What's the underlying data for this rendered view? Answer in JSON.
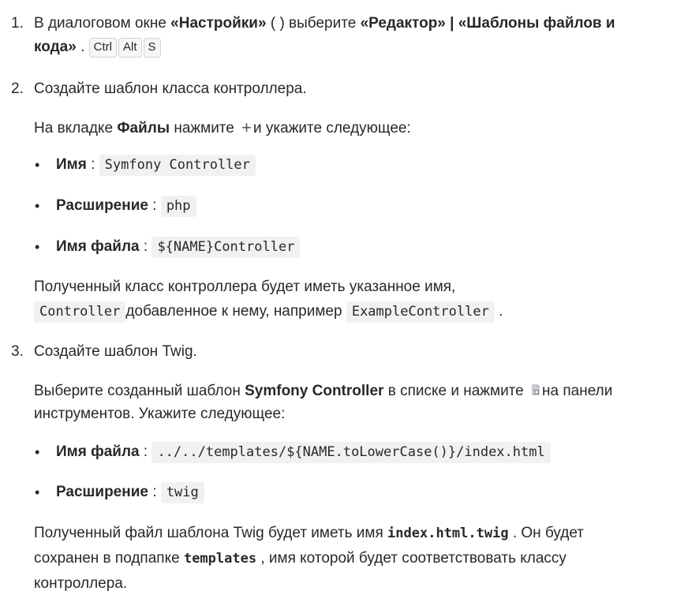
{
  "step1": {
    "number": "1.",
    "t1": "В диалоговом окне ",
    "settings": "«Настройки»",
    "t2": " ( ) выберите ",
    "editor": "«Редактор» | «Шаблоны файлов и",
    "code_kw": "кода»",
    "t3": " .",
    "keys": [
      "Ctrl",
      "Alt",
      "S"
    ]
  },
  "step2": {
    "number": "2.",
    "title": "Создайте шаблон класса контроллера.",
    "tab_pre": "На вкладке ",
    "tab_name": "Файлы",
    "tab_mid": " нажмите ",
    "plus_glyph": "+",
    "tab_post": "и укажите следующее:",
    "fields": [
      {
        "label": "Имя",
        "sep": " : ",
        "value": "Symfony Controller"
      },
      {
        "label": "Расширение",
        "sep": " : ",
        "value": "php"
      },
      {
        "label": "Имя файла",
        "sep": " : ",
        "value": "${NAME}Controller"
      }
    ],
    "result_line1": "Полученный класс контроллера будет иметь указанное имя,",
    "result_code1": "Controller",
    "result_mid": "добавленное к нему, например ",
    "result_code2": "ExampleController",
    "result_end": " ."
  },
  "step3": {
    "number": "3.",
    "title": "Создайте шаблон Twig.",
    "sel_pre": "Выберите созданный шаблон ",
    "sel_name": "Symfony Controller",
    "sel_mid": " в списке и нажмите ",
    "sel_post": "на панели",
    "sel_line2": "инструментов. Укажите следующее:",
    "fields": [
      {
        "label": "Имя файла",
        "sep": " : ",
        "value": "../../templates/${NAME.toLowerCase()}/index.html"
      },
      {
        "label": "Расширение",
        "sep": " : ",
        "value": "twig"
      }
    ],
    "res_pre": "Полученный файл шаблона Twig будет иметь имя ",
    "res_file": "index.html.twig",
    "res_mid": " . Он будет",
    "res_line2_pre": "сохранен в подпапке ",
    "res_folder": "templates",
    "res_line2_post": " , имя которой будет соответствовать классу",
    "res_line3": "контроллера."
  },
  "colors": {
    "text": "#27282c",
    "code_bg": "#f1f1f1",
    "kbd_border": "#d4d4d4"
  },
  "icons": {
    "plus": "plus-icon",
    "template": "add-child-template-icon"
  }
}
